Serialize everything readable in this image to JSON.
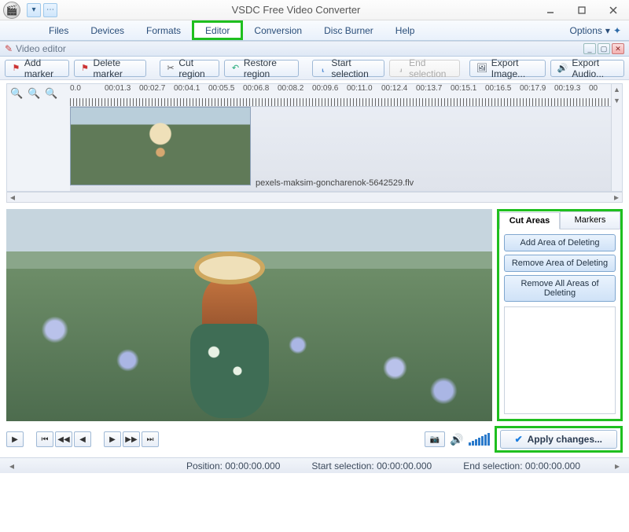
{
  "window": {
    "title": "VSDC Free Video Converter"
  },
  "ribbon": {
    "tabs": [
      "Files",
      "Devices",
      "Formats",
      "Editor",
      "Conversion",
      "Disc Burner",
      "Help"
    ],
    "options_label": "Options"
  },
  "subwindow": {
    "title": "Video editor"
  },
  "toolbar": {
    "add_marker": "Add marker",
    "delete_marker": "Delete marker",
    "cut_region": "Cut region",
    "restore_region": "Restore region",
    "start_selection": "Start selection",
    "end_selection": "End selection",
    "export_image": "Export Image...",
    "export_audio": "Export Audio..."
  },
  "timeline": {
    "ticks": [
      "0.0",
      "00:01.3",
      "00:02.7",
      "00:04.1",
      "00:05.5",
      "00:06.8",
      "00:08.2",
      "00:09.6",
      "00:11.0",
      "00:12.4",
      "00:13.7",
      "00:15.1",
      "00:16.5",
      "00:17.9",
      "00:19.3",
      "00"
    ],
    "filename": "pexels-maksim-goncharenok-5642529.flv"
  },
  "sidepanel": {
    "tab_cut": "Cut Areas",
    "tab_markers": "Markers",
    "add_area": "Add Area of Deleting",
    "remove_area": "Remove Area of Deleting",
    "remove_all": "Remove All Areas of Deleting"
  },
  "apply": {
    "label": "Apply changes..."
  },
  "status": {
    "position_label": "Position:",
    "position_value": "00:00:00.000",
    "start_label": "Start selection:",
    "start_value": "00:00:00.000",
    "end_label": "End selection:",
    "end_value": "00:00:00.000"
  }
}
